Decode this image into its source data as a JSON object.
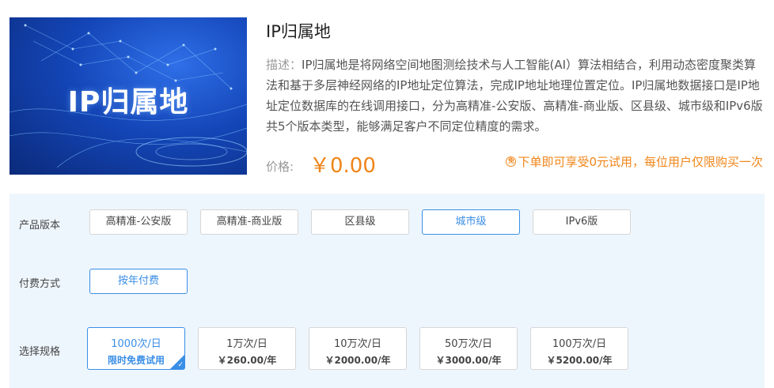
{
  "banner": {
    "text": "IP归属地"
  },
  "product": {
    "title": "IP归属地",
    "desc_label": "描述：",
    "description": "IP归属地是将网络空间地图测绘技术与人工智能(AI）算法相结合，利用动态密度聚类算法和基于多层神经网络的IP地址定位算法，完成IP地址地理位置定位。IP归属地数据接口是IP地址定位数据库的在线调用接口，分为高精准-公安版、高精准-商业版、区县级、城市级和IPv6版共5个版本类型，能够满足客户不同定位精度的需求。",
    "price_label": "价格:",
    "price_value": "￥0.00",
    "promo_icon": "免",
    "promo_text": "下单即可享受0元试用，每位用户仅限购买一次"
  },
  "options": {
    "version_label": "产品版本",
    "versions": [
      "高精准-公安版",
      "高精准-商业版",
      "区县级",
      "城市级",
      "IPv6版"
    ],
    "selected_version": "城市级",
    "payment_label": "付费方式",
    "payments": [
      "按年付费"
    ],
    "spec_label": "选择规格",
    "specs": [
      {
        "name": "1000次/日",
        "price": "限时免费试用"
      },
      {
        "name": "1万次/日",
        "price": "￥260.00/年"
      },
      {
        "name": "10万次/日",
        "price": "￥2000.00/年"
      },
      {
        "name": "50万次/日",
        "price": "￥3000.00/年"
      },
      {
        "name": "100万次/日",
        "price": "￥5200.00/年"
      }
    ]
  },
  "colors": {
    "accent": "#3a8ee6",
    "price": "#f08519",
    "panel_bg": "#eef6fd"
  },
  "icons": {
    "selected_check": "check-icon",
    "promo": "free-badge-icon"
  }
}
